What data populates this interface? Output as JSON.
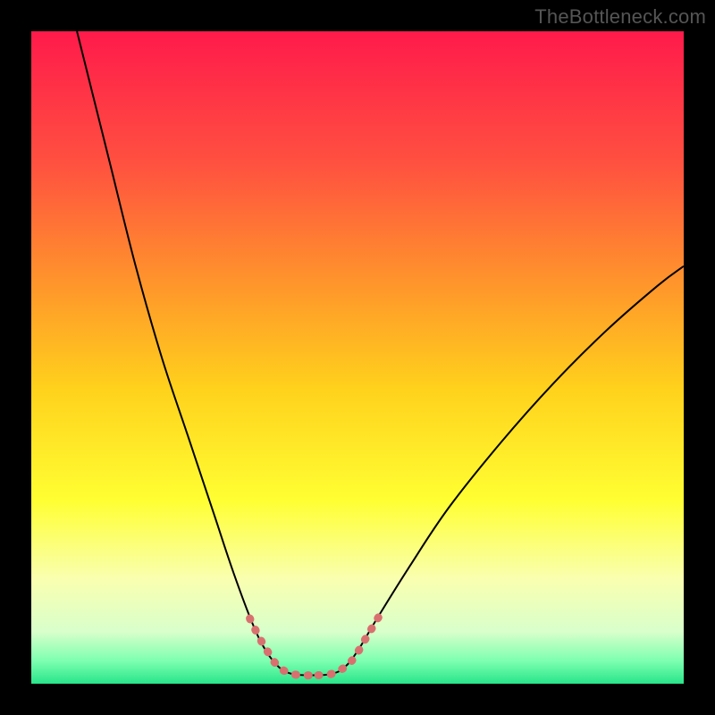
{
  "watermark": "TheBottleneck.com",
  "chart_data": {
    "type": "line",
    "title": "",
    "xlabel": "",
    "ylabel": "",
    "xlim": [
      0,
      100
    ],
    "ylim": [
      0,
      100
    ],
    "grid": false,
    "legend": false,
    "background_gradient": {
      "stops": [
        {
          "offset": 0.0,
          "color": "#ff1a4b"
        },
        {
          "offset": 0.2,
          "color": "#ff5040"
        },
        {
          "offset": 0.4,
          "color": "#ff9a2a"
        },
        {
          "offset": 0.55,
          "color": "#ffd21c"
        },
        {
          "offset": 0.72,
          "color": "#ffff33"
        },
        {
          "offset": 0.84,
          "color": "#f9ffb0"
        },
        {
          "offset": 0.92,
          "color": "#d9ffcb"
        },
        {
          "offset": 0.965,
          "color": "#7dffb0"
        },
        {
          "offset": 1.0,
          "color": "#28e58a"
        }
      ]
    },
    "series": [
      {
        "name": "bottleneck-curve",
        "stroke": "#000000",
        "stroke_width": 2,
        "points": [
          {
            "x": 7.0,
            "y": 100.0
          },
          {
            "x": 9.0,
            "y": 92.0
          },
          {
            "x": 12.0,
            "y": 80.0
          },
          {
            "x": 16.0,
            "y": 64.0
          },
          {
            "x": 20.0,
            "y": 50.0
          },
          {
            "x": 24.0,
            "y": 38.0
          },
          {
            "x": 28.0,
            "y": 26.0
          },
          {
            "x": 31.0,
            "y": 17.0
          },
          {
            "x": 34.0,
            "y": 9.0
          },
          {
            "x": 36.0,
            "y": 5.0
          },
          {
            "x": 38.0,
            "y": 2.5
          },
          {
            "x": 40.0,
            "y": 1.5
          },
          {
            "x": 43.0,
            "y": 1.3
          },
          {
            "x": 46.0,
            "y": 1.5
          },
          {
            "x": 48.0,
            "y": 2.5
          },
          {
            "x": 50.0,
            "y": 5.0
          },
          {
            "x": 53.0,
            "y": 10.0
          },
          {
            "x": 58.0,
            "y": 18.0
          },
          {
            "x": 64.0,
            "y": 27.0
          },
          {
            "x": 72.0,
            "y": 37.0
          },
          {
            "x": 80.0,
            "y": 46.0
          },
          {
            "x": 88.0,
            "y": 54.0
          },
          {
            "x": 96.0,
            "y": 61.0
          },
          {
            "x": 100.0,
            "y": 64.0
          }
        ]
      },
      {
        "name": "highlight-left",
        "stroke": "#d97070",
        "stroke_width": 9,
        "dash": "1 13",
        "linecap": "round",
        "points": [
          {
            "x": 33.5,
            "y": 10.0
          },
          {
            "x": 35.0,
            "y": 7.0
          },
          {
            "x": 36.5,
            "y": 4.5
          },
          {
            "x": 38.0,
            "y": 2.5
          },
          {
            "x": 40.0,
            "y": 1.5
          },
          {
            "x": 42.0,
            "y": 1.3
          },
          {
            "x": 44.0,
            "y": 1.3
          }
        ]
      },
      {
        "name": "highlight-right",
        "stroke": "#d97070",
        "stroke_width": 9,
        "dash": "1 13",
        "linecap": "round",
        "points": [
          {
            "x": 44.0,
            "y": 1.3
          },
          {
            "x": 46.0,
            "y": 1.5
          },
          {
            "x": 48.0,
            "y": 2.5
          },
          {
            "x": 49.5,
            "y": 4.0
          },
          {
            "x": 51.0,
            "y": 6.5
          },
          {
            "x": 52.5,
            "y": 9.0
          },
          {
            "x": 54.0,
            "y": 11.5
          }
        ]
      }
    ]
  }
}
